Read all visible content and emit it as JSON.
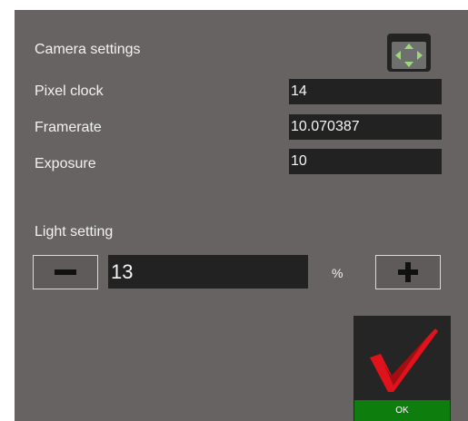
{
  "camera": {
    "title": "Camera settings",
    "fields": [
      {
        "label": "Pixel clock",
        "value": "14"
      },
      {
        "label": "Framerate",
        "value": "10.070387"
      },
      {
        "label": "Exposure",
        "value": "10"
      }
    ]
  },
  "light": {
    "title": "Light setting",
    "value": "13",
    "unit": "%"
  },
  "ok": {
    "label": "OK"
  },
  "icons": {
    "move": "move-arrows-icon",
    "minus": "minus-icon",
    "plus": "plus-icon",
    "check": "checkmark-icon"
  },
  "colors": {
    "background": "#676363",
    "field": "#222222",
    "arrow": "#9fd87a",
    "ok_bar": "#0d7d0d",
    "check": "#e0121b"
  }
}
